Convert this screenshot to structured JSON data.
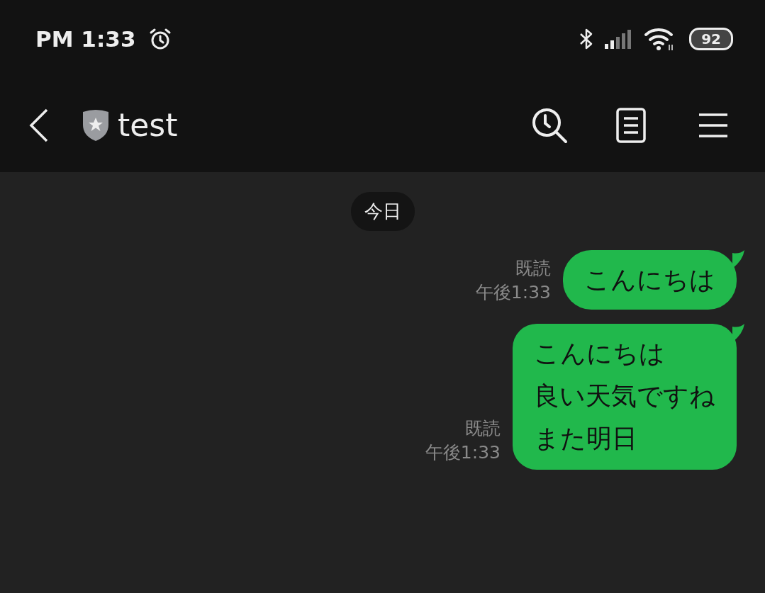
{
  "status_bar": {
    "time": "PM 1:33",
    "battery": "92"
  },
  "header": {
    "title": "test"
  },
  "date_divider": "今日",
  "messages": [
    {
      "lines": [
        "こんにちは"
      ],
      "read": "既読",
      "time": "午後1:33",
      "outgoing": true
    },
    {
      "lines": [
        "こんにちは",
        "良い天気ですね",
        "また明日"
      ],
      "read": "既読",
      "time": "午後1:33",
      "outgoing": true
    }
  ]
}
